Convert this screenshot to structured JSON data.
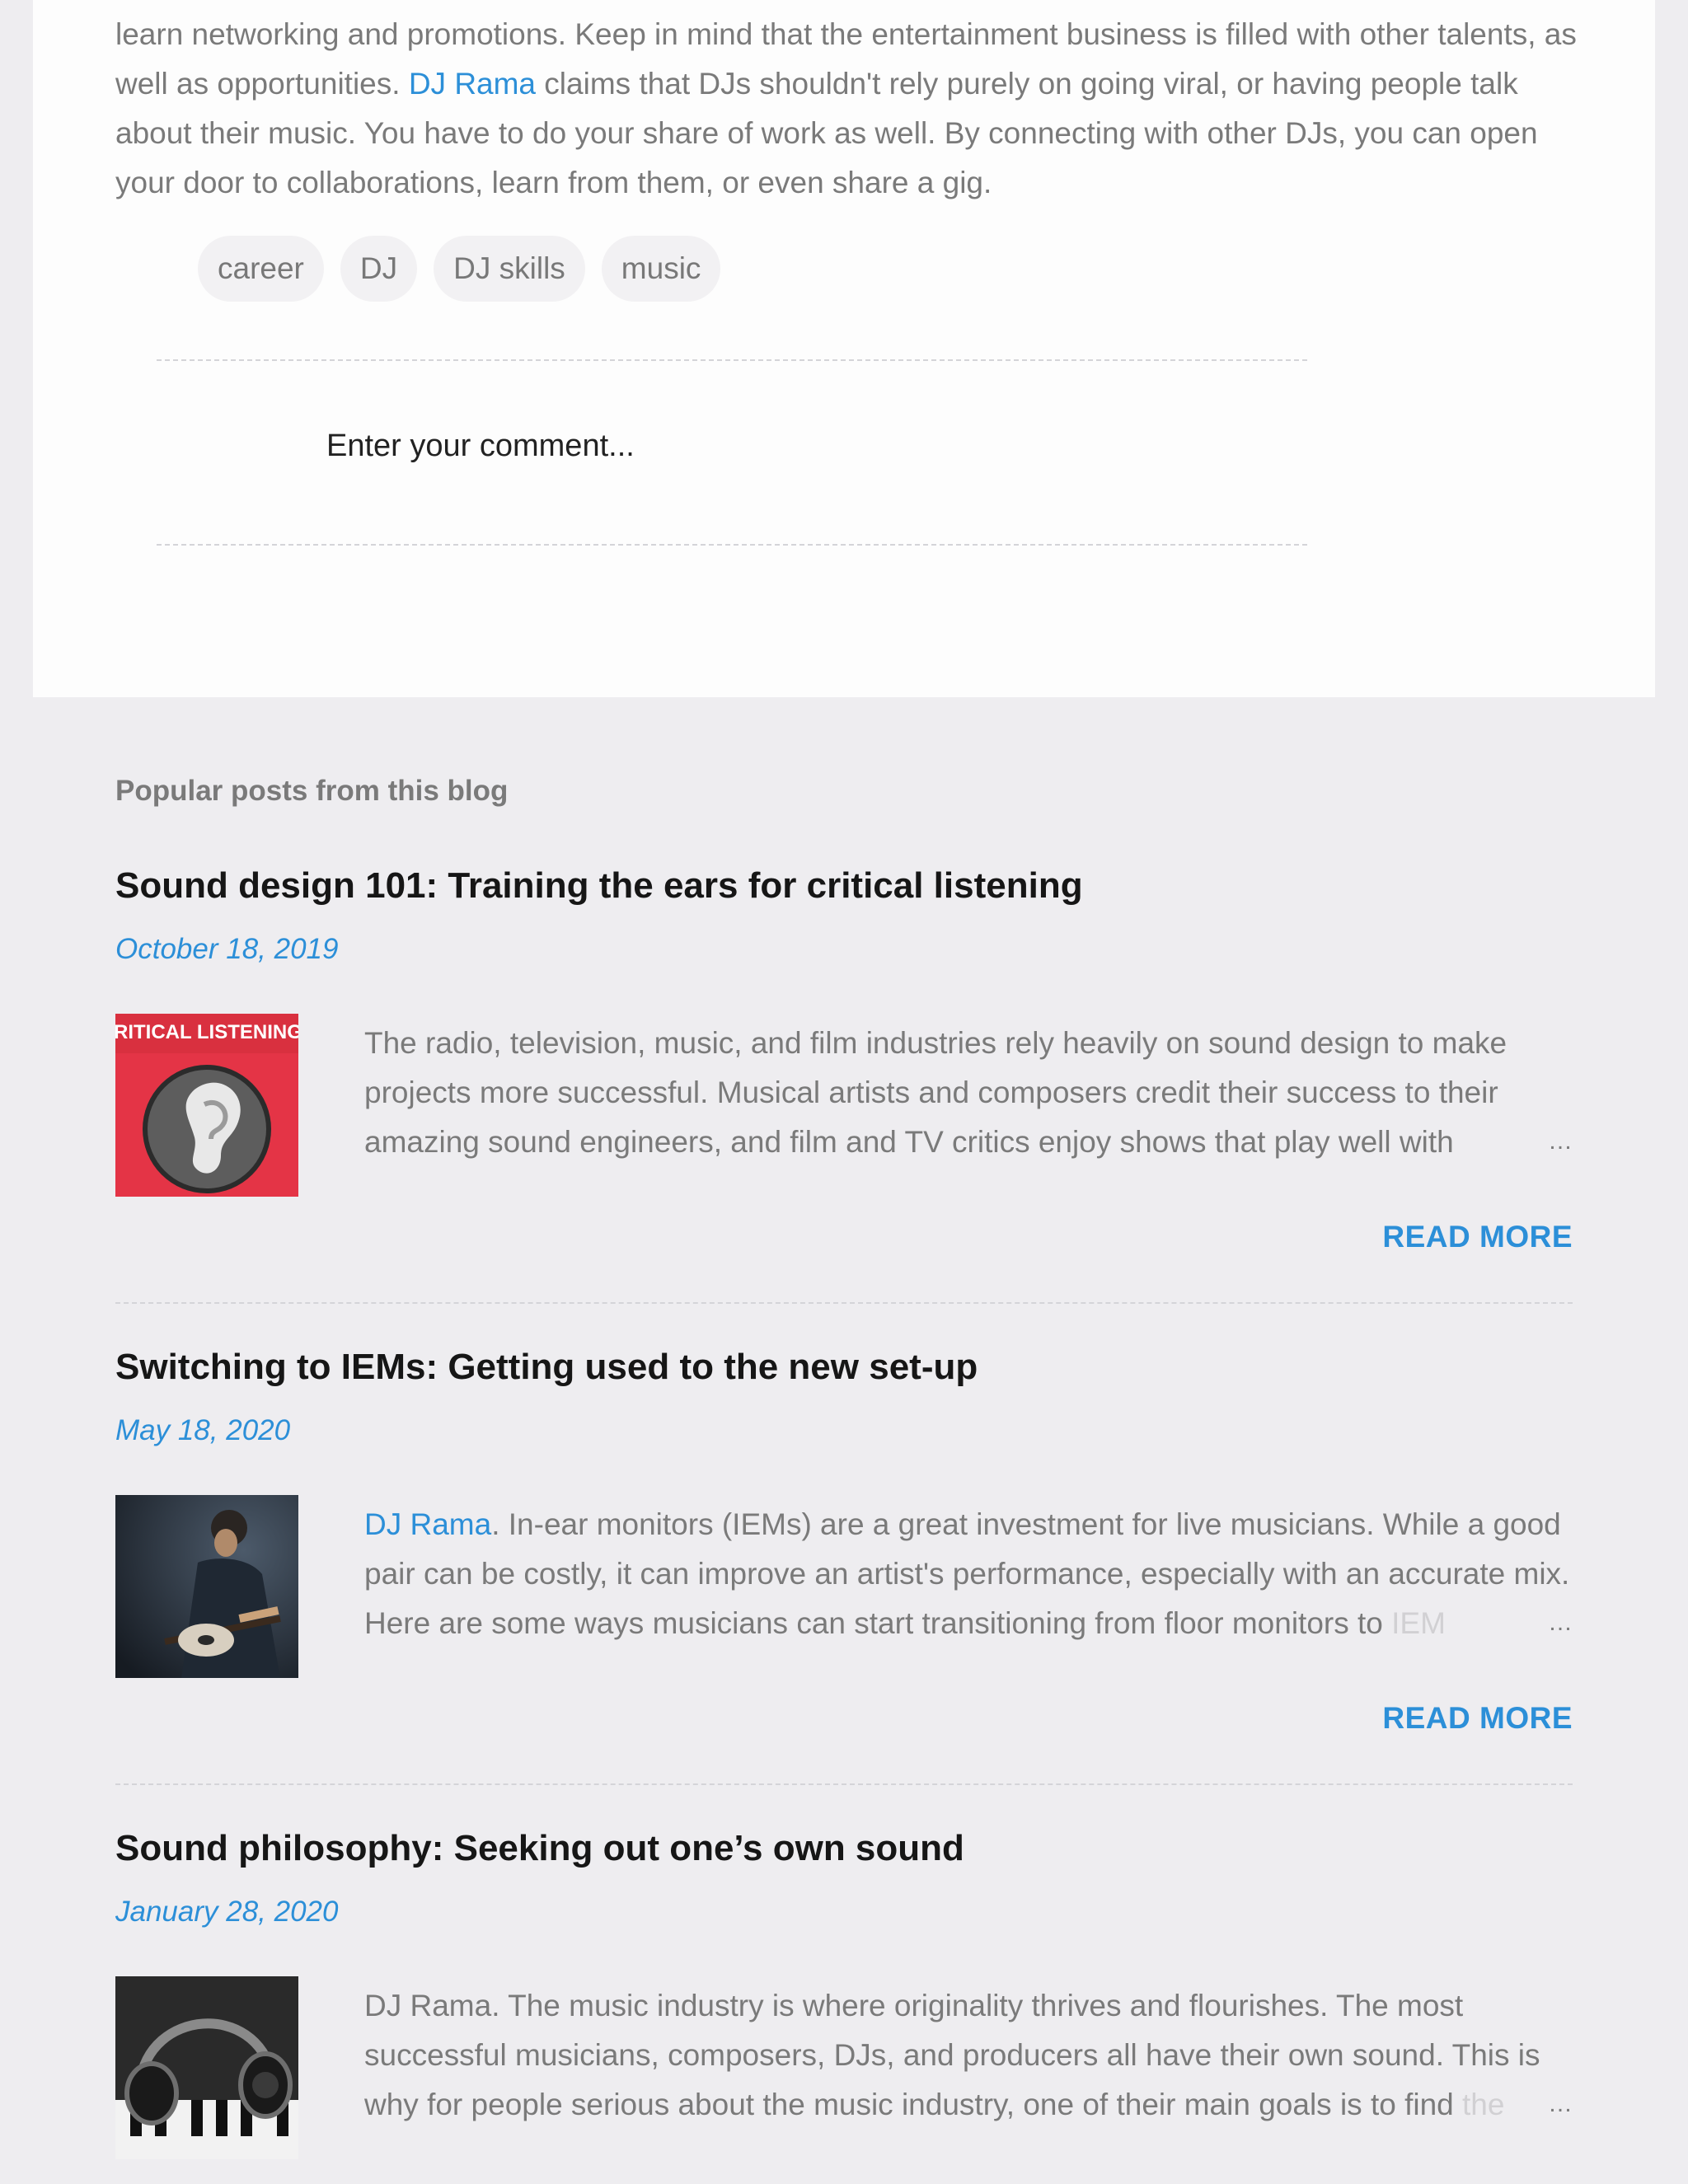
{
  "article": {
    "body_part1": "learn networking and promotions. Keep in mind that the entertainment business is filled with other talents, as well as opportunities. ",
    "body_link": "DJ Rama",
    "body_part2": " claims that DJs shouldn't rely purely on going viral, or having people talk about their music. You have to do your share of work as well. By connecting with other DJs, you can open your door to collaborations, learn from them, or even share a gig.",
    "labels": [
      "career",
      "DJ",
      "DJ skills",
      "music"
    ]
  },
  "comment": {
    "placeholder": "Enter your comment..."
  },
  "popular": {
    "heading": "Popular posts from this blog",
    "read_more": "READ MORE",
    "ellipsis": "…",
    "posts": [
      {
        "title": "Sound design 101: Training the ears for critical listening",
        "date": "October 18, 2019",
        "thumb_text": "RITICAL LISTENING",
        "snippet_main": "The radio, television, music, and film industries rely heavily on sound design to make projects more successful. Musical artists and composers credit their success to their amazing sound engineers, and film and TV critics enjoy shows that play well with",
        "snippet_link": "",
        "snippet_fade": ""
      },
      {
        "title": "Switching to IEMs: Getting used to the new set-up",
        "date": "May 18, 2020",
        "snippet_link": "DJ Rama",
        "snippet_main": ". In-ear monitors (IEMs) are a great investment for live musicians. While a good pair can be costly, it can improve an artist's performance, especially with an accurate mix. Here are some ways musicians can start transitioning from floor monitors to ",
        "snippet_fade": "IEM"
      },
      {
        "title": "Sound philosophy: Seeking out one’s own sound",
        "date": "January 28, 2020",
        "snippet_link": "",
        "snippet_main": "DJ Rama. The music industry is where originality thrives and flourishes. The most successful musicians, composers, DJs, and producers all have their own sound. This is why for people serious about the music industry, one of their main goals is to find ",
        "snippet_fade": "the"
      }
    ]
  },
  "colors": {
    "link": "#2c8fd8",
    "page_bg": "#eeedf0",
    "card_bg": "#fdfdfd",
    "thumb1_red": "#e8384a"
  },
  "icons": [
    "ear-thumbnail",
    "guitarist-thumbnail",
    "headphones-piano-thumbnail"
  ]
}
